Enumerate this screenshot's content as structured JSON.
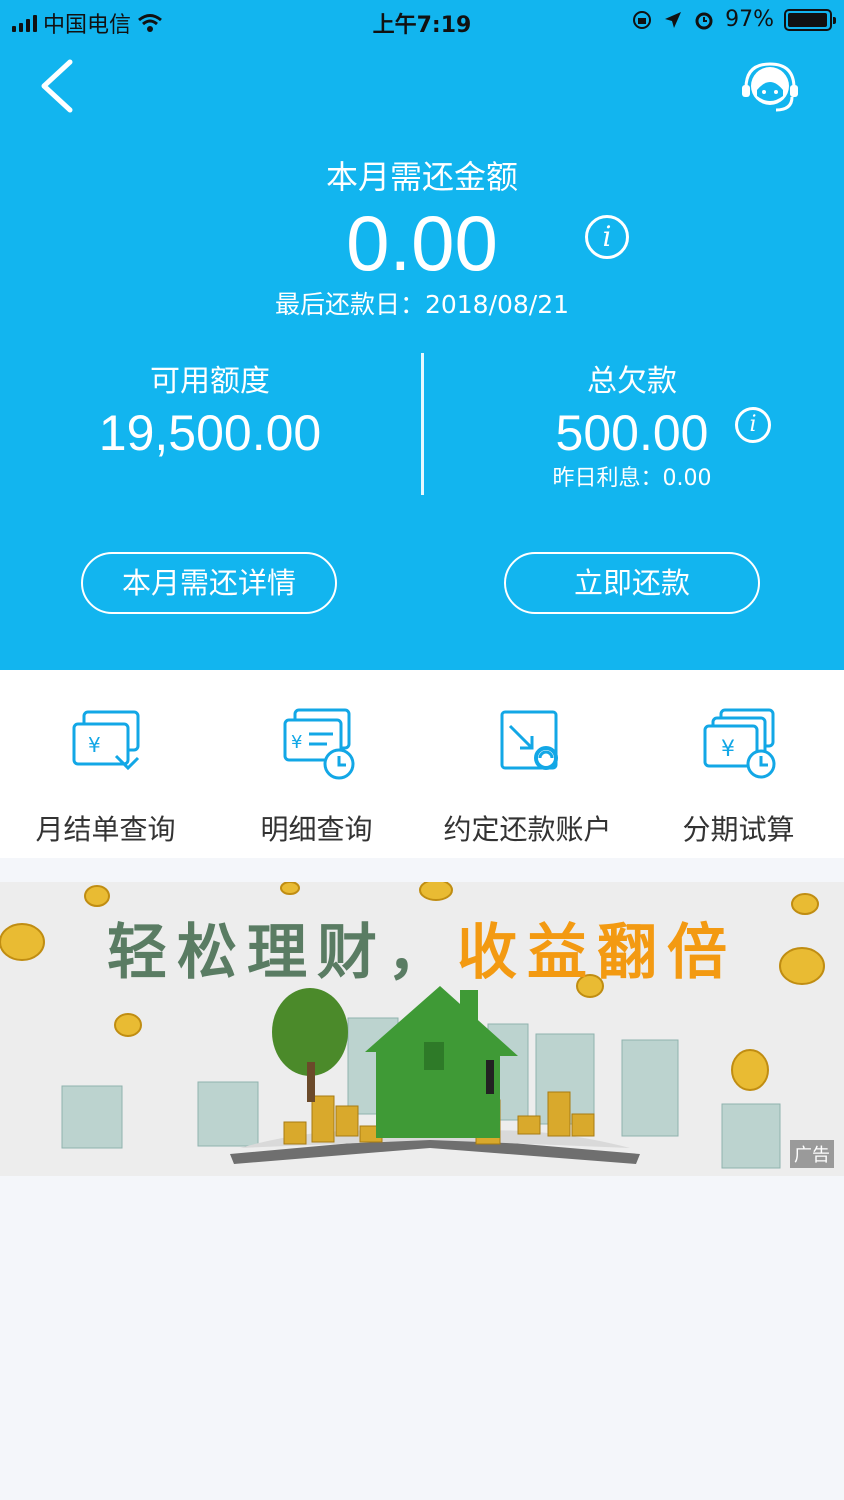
{
  "status_bar": {
    "carrier": "中国电信",
    "time": "上午7:19",
    "battery": "97%"
  },
  "summary": {
    "title": "本月需还金额",
    "amount": "0.00",
    "due_date_label": "最后还款日：2018/08/21",
    "available_label": "可用额度",
    "available_value": "19,500.00",
    "total_owed_label": "总欠款",
    "total_owed_value": "500.00",
    "interest_label": "昨日利息：0.00"
  },
  "actions": {
    "detail_button": "本月需还详情",
    "pay_button": "立即还款"
  },
  "menu": [
    {
      "label": "月结单查询",
      "icon": "statement-icon"
    },
    {
      "label": "明细查询",
      "icon": "detail-icon"
    },
    {
      "label": "约定还款账户",
      "icon": "repay-account-icon"
    },
    {
      "label": "分期试算",
      "icon": "installment-icon"
    }
  ],
  "banner": {
    "headline_part1": "轻松理财，",
    "headline_part2": "收益翻倍",
    "ad_tag": "广告"
  },
  "colors": {
    "primary": "#12b5ef",
    "icon": "#12a7e6",
    "highlight": "#f39a12"
  }
}
